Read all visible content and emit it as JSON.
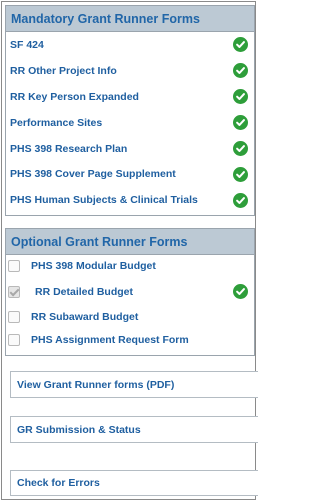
{
  "mandatory": {
    "title": "Mandatory Grant Runner Forms",
    "items": [
      {
        "label": "SF 424",
        "complete": true
      },
      {
        "label": "RR Other Project Info",
        "complete": true
      },
      {
        "label": "RR Key Person Expanded",
        "complete": true
      },
      {
        "label": "Performance Sites",
        "complete": true
      },
      {
        "label": "PHS 398 Research Plan",
        "complete": true
      },
      {
        "label": "PHS 398 Cover Page Supplement",
        "complete": true
      },
      {
        "label": "PHS Human Subjects & Clinical Trials",
        "complete": true
      }
    ]
  },
  "optional": {
    "title": "Optional Grant Runner Forms",
    "items": [
      {
        "label": "PHS 398 Modular Budget",
        "checked": false,
        "complete": false
      },
      {
        "label": "RR Detailed Budget",
        "checked": true,
        "complete": true
      },
      {
        "label": "RR Subaward Budget",
        "checked": false,
        "complete": false
      },
      {
        "label": "PHS Assignment Request Form",
        "checked": false,
        "complete": false
      }
    ]
  },
  "actions": {
    "view_pdf": "View Grant Runner forms (PDF)",
    "submission_status": "GR Submission & Status",
    "check_errors": "Check for Errors"
  },
  "colors": {
    "header_bg": "#bcc9d4",
    "link_blue": "#1f5fa0",
    "check_green": "#2e9e3a"
  }
}
